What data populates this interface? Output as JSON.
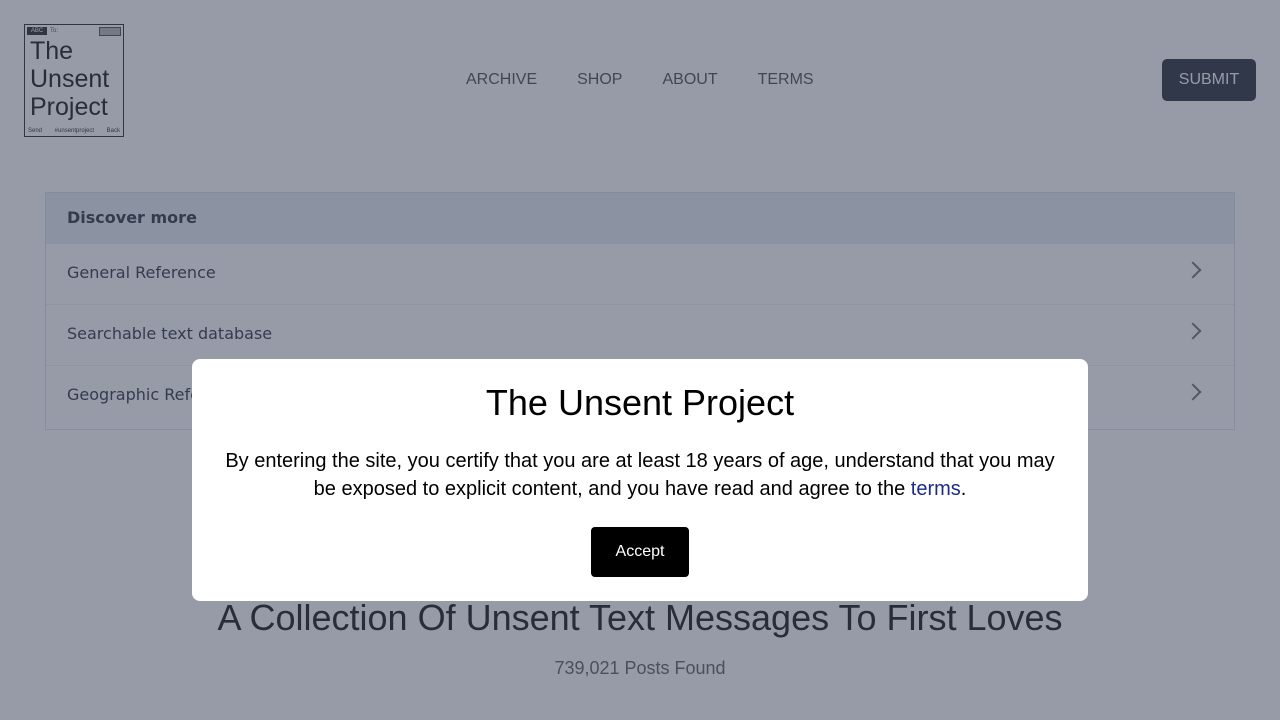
{
  "logo": {
    "badge": "ABC",
    "to_label": "To:",
    "title_line1": "The",
    "title_line2": "Unsent",
    "title_line3": "Project",
    "foot_left": "Send",
    "foot_mid": "#unsentproject",
    "foot_right": "Back"
  },
  "nav": {
    "items": [
      "ARCHIVE",
      "SHOP",
      "ABOUT",
      "TERMS"
    ]
  },
  "header": {
    "submit_label": "SUBMIT"
  },
  "discover": {
    "heading": "Discover more",
    "items": [
      "General Reference",
      "Searchable text database",
      "Geographic Reference"
    ]
  },
  "main": {
    "heading": "A Collection Of Unsent Text Messages To First Loves",
    "posts_found": "739,021 Posts Found"
  },
  "modal": {
    "title": "The Unsent Project",
    "message_before": "By entering the site, you certify that you are at least 18 years of age, understand that you may be exposed to explicit content, and you have read and agree to the ",
    "terms_link": "terms",
    "message_after": ".",
    "accept_label": "Accept"
  }
}
